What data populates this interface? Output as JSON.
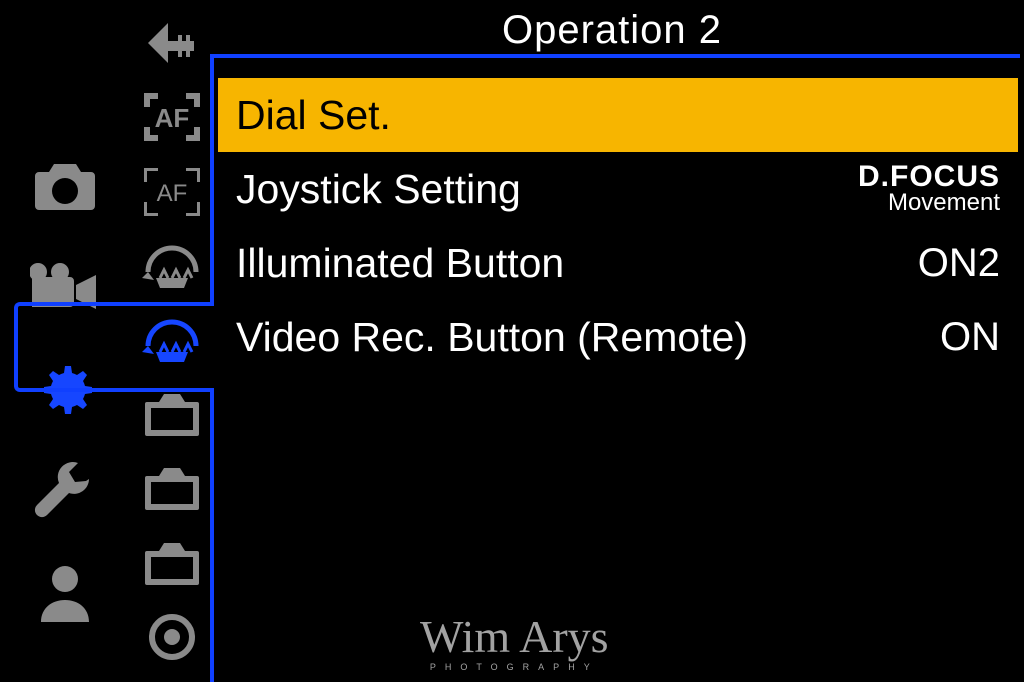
{
  "header": {
    "title": "Operation 2"
  },
  "primary_tabs": [
    {
      "id": "camera",
      "icon": "camera-icon",
      "active": false
    },
    {
      "id": "video",
      "icon": "video-icon",
      "active": false
    },
    {
      "id": "custom",
      "icon": "gear-icon",
      "active": true
    },
    {
      "id": "setup",
      "icon": "wrench-icon",
      "active": false
    },
    {
      "id": "mymenu",
      "icon": "person-icon",
      "active": false
    }
  ],
  "secondary_tabs": [
    {
      "id": "back",
      "icon": "back-arrow-icon"
    },
    {
      "id": "af-bold",
      "icon": "af-corners-bold-icon"
    },
    {
      "id": "af-thin",
      "icon": "af-corners-thin-icon"
    },
    {
      "id": "dial-1",
      "icon": "dial-arc-icon"
    },
    {
      "id": "dial-2",
      "icon": "dial-arc-icon",
      "active": true
    },
    {
      "id": "monitor-1",
      "icon": "camera-outline-icon"
    },
    {
      "id": "monitor-2",
      "icon": "camera-outline-icon"
    },
    {
      "id": "monitor-3",
      "icon": "camera-outline-icon"
    },
    {
      "id": "lens",
      "icon": "lens-circle-icon"
    }
  ],
  "menu": {
    "items": [
      {
        "label": "Dial Set.",
        "value": "",
        "selected": true
      },
      {
        "label": "Joystick Setting",
        "value_top": "D.FOCUS",
        "value_bottom": "Movement",
        "selected": false
      },
      {
        "label": "Illuminated Button",
        "value": "ON2",
        "selected": false
      },
      {
        "label": "Video Rec. Button (Remote)",
        "value": "ON",
        "selected": false
      }
    ]
  },
  "watermark": {
    "name": "Wim Arys",
    "sub": "PHOTOGRAPHY"
  }
}
